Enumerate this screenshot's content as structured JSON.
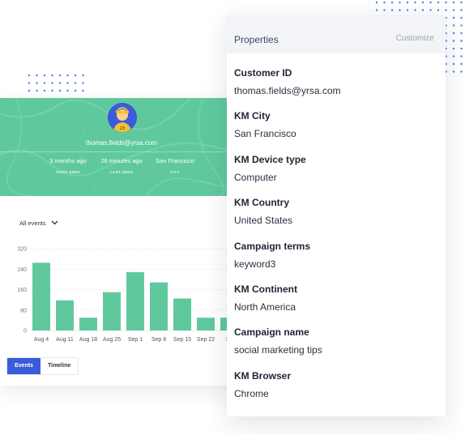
{
  "profile": {
    "email": "thomas.fields@yrsa.com",
    "stats": [
      {
        "value": "3 months ago",
        "label": "FIRST SEEN"
      },
      {
        "value": "26 minutes ago",
        "label": "LAST SEEN"
      },
      {
        "value": "San Francisco",
        "label": "CITY"
      }
    ]
  },
  "events_filter": {
    "selected": "All events"
  },
  "chart_data": {
    "type": "bar",
    "categories": [
      "Aug 4",
      "Aug 11",
      "Aug 18",
      "Aug 25",
      "Sep 1",
      "Sep 8",
      "Sep 15",
      "Sep 22",
      "Se"
    ],
    "values": [
      265,
      118,
      50,
      150,
      228,
      188,
      125,
      50,
      50
    ],
    "yticks": [
      "320",
      "240",
      "160",
      "80",
      "0"
    ],
    "ylim": [
      0,
      320
    ],
    "bar_color": "#5fc99d",
    "grid": true
  },
  "tabs": [
    {
      "label": "Events",
      "active": true
    },
    {
      "label": "Timeline",
      "active": false
    }
  ],
  "properties": {
    "title": "Properties",
    "customize_label": "Customize",
    "items": [
      {
        "key": "Customer ID",
        "value": "thomas.fields@yrsa.com"
      },
      {
        "key": "KM City",
        "value": "San Francisco"
      },
      {
        "key": "KM Device type",
        "value": "Computer"
      },
      {
        "key": "KM Country",
        "value": "United States"
      },
      {
        "key": "Campaign terms",
        "value": "keyword3"
      },
      {
        "key": "KM Continent",
        "value": "North America"
      },
      {
        "key": "Campaign name",
        "value": "social marketing tips"
      },
      {
        "key": "KM Browser",
        "value": "Chrome"
      }
    ]
  },
  "colors": {
    "accent": "#3b5bdb",
    "header_green": "#5fc99d",
    "dots": "#4a7cf0"
  }
}
